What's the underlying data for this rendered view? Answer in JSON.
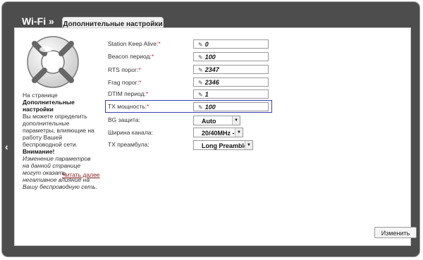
{
  "header": {
    "title": "Wi-Fi »",
    "tab_label": "Дополнительные настройки"
  },
  "sidebar_info": {
    "intro": "На странице",
    "page_name": "Дополнительные настройки",
    "description": "Вы можете определить дополнительные параметры, влияющие на работу Вашей беспроводной сети.",
    "warning_title": "Внимание!",
    "warning_text": "Изменение параметров на данной странице могут оказать негативное влияние на Вашу беспроводную сеть.",
    "read_more": "Читать далее"
  },
  "fields": {
    "station_keep_alive": {
      "label": "Station Keep Alive:",
      "value": "0"
    },
    "beacon_period": {
      "label": "Beacon период:",
      "value": "100"
    },
    "rts_threshold": {
      "label": "RTS порог:",
      "value": "2347"
    },
    "frag_threshold": {
      "label": "Frag порог:",
      "value": "2346"
    },
    "dtim_period": {
      "label": "DTIM период:",
      "value": "1"
    },
    "tx_power": {
      "label": "TX мощность:",
      "value": "100"
    },
    "bg_protection": {
      "label": "BG защита:",
      "value": "Auto"
    },
    "channel_width": {
      "label": "Ширина канала:",
      "value": "20/40MHz -"
    },
    "tx_preamble": {
      "label": "TX преамбула:",
      "value": "Long Preamble"
    }
  },
  "required_mark": "*",
  "pencil_glyph": "✎",
  "actions": {
    "apply_label": "Изменить"
  },
  "colors": {
    "frame": "#4d4d4d",
    "highlight": "#3a3fb5",
    "required": "#dd2233",
    "link": "#8b1a1a"
  }
}
